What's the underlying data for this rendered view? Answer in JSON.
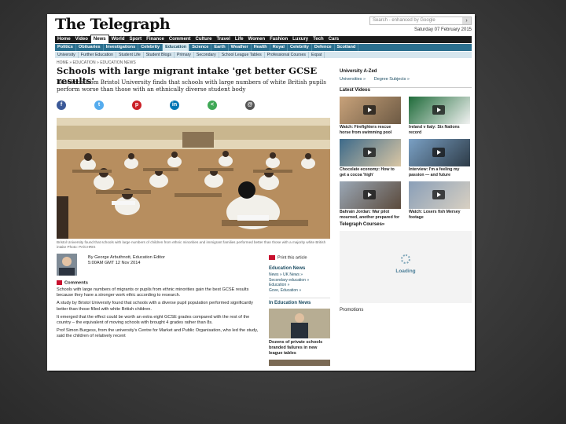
{
  "masthead": {
    "logo": "The Telegraph",
    "search_placeholder": "Search - enhanced by Google",
    "search_button": "›",
    "date": "Saturday 07 February 2015"
  },
  "nav_primary": [
    "Home",
    "Video",
    "News",
    "World",
    "Sport",
    "Finance",
    "Comment",
    "Culture",
    "Travel",
    "Life",
    "Women",
    "Fashion",
    "Luxury",
    "Tech",
    "Cars"
  ],
  "nav_primary_active": "News",
  "nav_secondary": [
    "Politics",
    "Obituaries",
    "Investigations",
    "Celebrity",
    "Education",
    "Science",
    "Earth",
    "Weather",
    "Health",
    "Royal",
    "Celebrity",
    "Defence",
    "Scotland"
  ],
  "nav_secondary_active": "Education",
  "nav_tertiary": [
    "University",
    "Further Education",
    "Student Life",
    "Student Blogs",
    "Primary",
    "Secondary",
    "School League Tables",
    "Professional Courses",
    "Expat"
  ],
  "breadcrumb": "HOME » EDUCATION » EDUCATION NEWS",
  "article": {
    "headline": "Schools with large migrant intake 'get better GCSE results'",
    "standfirst": "Research from Bristol University finds that schools with large numbers of white British pupils perform worse than those with an ethnically diverse student body",
    "caption": "Bristol University found that schools with large numbers of children from ethnic minorities and immigrant families performed better than those with a majority white British intake   Photo: PA/CHRIS",
    "byline_author": "By George Arbuthnott, Education Editor",
    "byline_time": "5:00AM GMT 12 Nov 2014",
    "comments_label": "Comments",
    "paragraphs": [
      "Schools with large numbers of migrants or pupils from ethnic minorities gain the best GCSE results because they have a stronger work ethic according to research.",
      "A study by Bristol University found that schools with a diverse pupil population performed significantly better than those filled with white British children.",
      "It emerged that the effect could be worth an extra eight GCSE grades compared with the rest of the country – the equivalent of moving schools with brought 4 grades rather than 8s.",
      "Prof Simon Burgess, from the university's Centre for Market and Public Organisation, who led the study, said the children of relatively recent"
    ]
  },
  "share_icons": [
    {
      "name": "facebook-icon",
      "glyph": "f",
      "color": "#3b5998"
    },
    {
      "name": "twitter-icon",
      "glyph": "t",
      "color": "#55acee"
    },
    {
      "name": "pinterest-icon",
      "glyph": "p",
      "color": "#cb2027"
    },
    {
      "name": "linkedin-icon",
      "glyph": "in",
      "color": "#0077b5"
    },
    {
      "name": "share-icon",
      "glyph": "<",
      "color": "#3fa856"
    },
    {
      "name": "email-icon",
      "glyph": "@",
      "color": "#555555"
    }
  ],
  "middle": {
    "print_label": "Print this article",
    "news_head": "Education News",
    "news_links": [
      "News » UK News »",
      "Secondary education »",
      "Education »",
      "Gove, Education »"
    ],
    "in_education_head": "In Education News",
    "thumb_caption": "Dozens of private schools branded failures in new league tables"
  },
  "right": {
    "az_head": "University A-Zed",
    "az_links": [
      "Universities »",
      "Degree Subjects »"
    ],
    "videos_head": "Latest Videos",
    "videos": [
      {
        "caption": "Watch: Firefighters rescue horse from swimming pool"
      },
      {
        "caption": "Ireland v Italy: Six Nations record"
      },
      {
        "caption": "Chocolate economy: How to get a cocoa 'high'"
      },
      {
        "caption": "Interview: I'm a feeling my passion — and future"
      },
      {
        "caption": "Bahrain Jordan: War pilot mourned, another prepared for prison, killed"
      },
      {
        "caption": "Watch: Losers fish Mersey footage"
      }
    ],
    "courses_head": "Telegraph Courses»",
    "loading_label": "Loading",
    "promotions_head": "Promotions"
  }
}
